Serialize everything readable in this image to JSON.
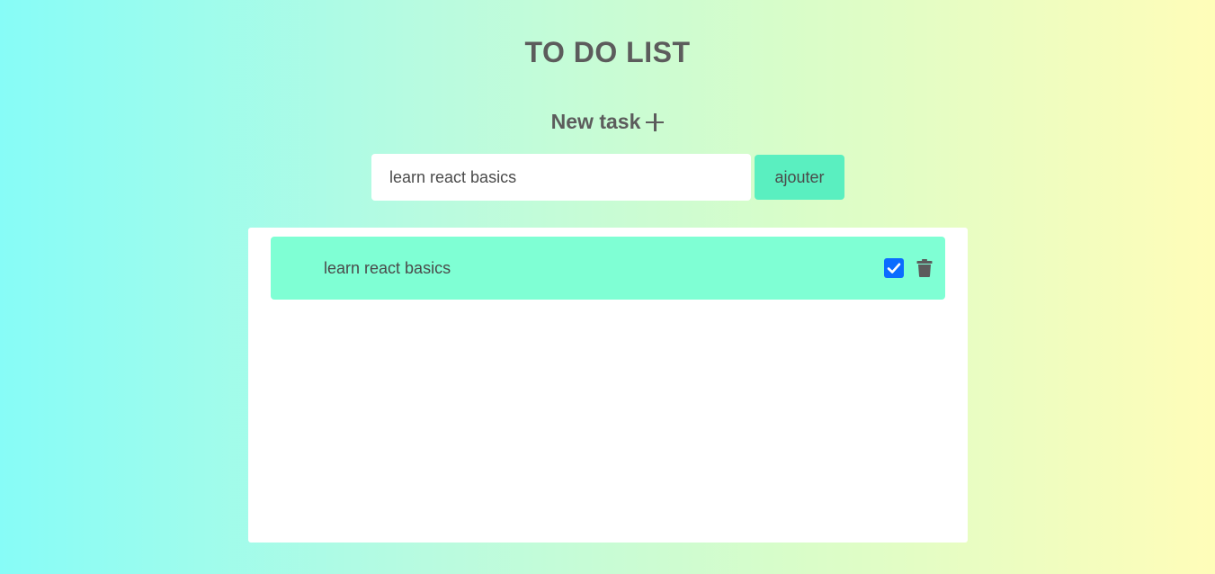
{
  "app": {
    "title": "TO DO LIST"
  },
  "new_task": {
    "heading": "New task",
    "icon": "plus-icon",
    "input_value": "learn react basics",
    "add_button_label": "ajouter"
  },
  "tasks": [
    {
      "text": "learn react basics",
      "completed": true,
      "actions": [
        "checkbox",
        "trash-icon"
      ]
    }
  ],
  "colors": {
    "accent": "#5aefc0",
    "task_bg": "#7fffd4",
    "checkbox": "#0b6cff",
    "text": "#5c5c5c",
    "gradient_start": "#87fcf7",
    "gradient_end": "#fffdb9"
  }
}
